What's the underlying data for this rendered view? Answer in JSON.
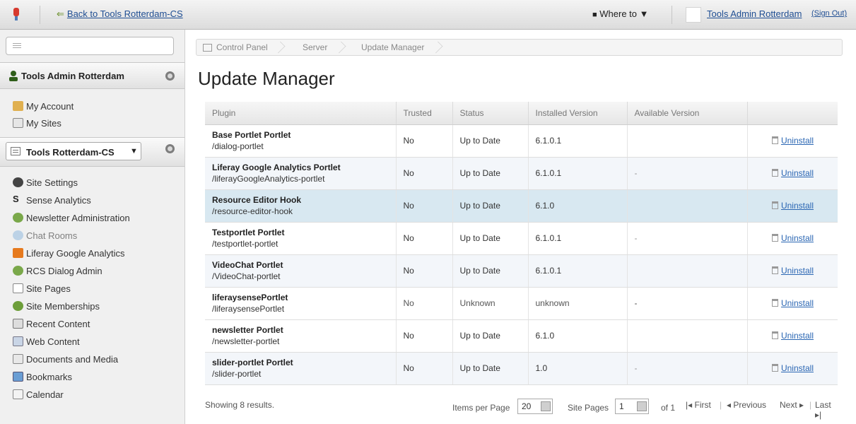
{
  "dockbar": {
    "back_label": "Back to Tools Rotterdam-CS",
    "where_to": "Where to ▼",
    "user_name": "Tools Admin Rotterdam",
    "sign_out": "(Sign Out)"
  },
  "sidebar": {
    "user_panel": {
      "title": "Tools Admin Rotterdam",
      "items": [
        {
          "label": "My Account",
          "icon": "account-icon"
        },
        {
          "label": "My Sites",
          "icon": "sites-icon"
        }
      ]
    },
    "site_panel": {
      "site_name": "Tools Rotterdam-CS",
      "items": [
        {
          "label": "Site Settings",
          "icon": "gear-icon"
        },
        {
          "label": "Sense Analytics",
          "icon": "s-icon"
        },
        {
          "label": "Newsletter Administration",
          "icon": "newsletter-icon"
        },
        {
          "label": "Chat Rooms",
          "icon": "chat-icon"
        },
        {
          "label": "Liferay Google Analytics",
          "icon": "analytics-icon"
        },
        {
          "label": "RCS Dialog Admin",
          "icon": "dialog-icon"
        },
        {
          "label": "Site Pages",
          "icon": "pages-icon"
        },
        {
          "label": "Site Memberships",
          "icon": "members-icon"
        },
        {
          "label": "Recent Content",
          "icon": "recent-icon"
        },
        {
          "label": "Web Content",
          "icon": "webcontent-icon"
        },
        {
          "label": "Documents and Media",
          "icon": "documents-icon"
        },
        {
          "label": "Bookmarks",
          "icon": "bookmarks-icon"
        },
        {
          "label": "Calendar",
          "icon": "calendar-icon"
        }
      ]
    }
  },
  "breadcrumb": [
    "Control Panel",
    "Server",
    "Update Manager"
  ],
  "page_title": "Update Manager",
  "table": {
    "headers": [
      "Plugin",
      "Trusted",
      "Status",
      "Installed Version",
      "Available Version",
      ""
    ],
    "rows": [
      {
        "name": "Base Portlet Portlet",
        "path": "/dialog-portlet",
        "trusted": "No",
        "status": "Up to Date",
        "installed": "6.1.0.1",
        "available": "",
        "action": "Uninstall"
      },
      {
        "name": "Liferay Google Analytics Portlet",
        "path": "/liferayGoogleAnalytics-portlet",
        "trusted": "No",
        "status": "Up to Date",
        "installed": "6.1.0.1",
        "available": "-",
        "action": "Uninstall"
      },
      {
        "name": "Resource Editor Hook",
        "path": "/resource-editor-hook",
        "trusted": "No",
        "status": "Up to Date",
        "installed": "6.1.0",
        "available": "",
        "action": "Uninstall"
      },
      {
        "name": "Testportlet Portlet",
        "path": "/testportlet-portlet",
        "trusted": "No",
        "status": "Up to Date",
        "installed": "6.1.0.1",
        "available": "-",
        "action": "Uninstall"
      },
      {
        "name": "VideoChat Portlet",
        "path": "/VideoChat-portlet",
        "trusted": "No",
        "status": "Up to Date",
        "installed": "6.1.0.1",
        "available": "",
        "action": "Uninstall"
      },
      {
        "name": "liferaysensePortlet",
        "path": "/liferaysensePortlet",
        "trusted": "No",
        "status": "Unknown",
        "installed": "unknown",
        "available": "-",
        "action": "Uninstall"
      },
      {
        "name": "newsletter Portlet",
        "path": "/newsletter-portlet",
        "trusted": "No",
        "status": "Up to Date",
        "installed": "6.1.0",
        "available": "",
        "action": "Uninstall"
      },
      {
        "name": "slider-portlet Portlet",
        "path": "/slider-portlet",
        "trusted": "No",
        "status": "Up to Date",
        "installed": "1.0",
        "available": "-",
        "action": "Uninstall"
      }
    ]
  },
  "footer": {
    "showing": "Showing 8 results.",
    "items_per_page_label": "Items per Page",
    "items_per_page": "20",
    "site_pages_label": "Site Pages",
    "page": "1",
    "of": "of 1",
    "first": "First",
    "previous": "Previous",
    "next": "Next",
    "last": "Last"
  }
}
